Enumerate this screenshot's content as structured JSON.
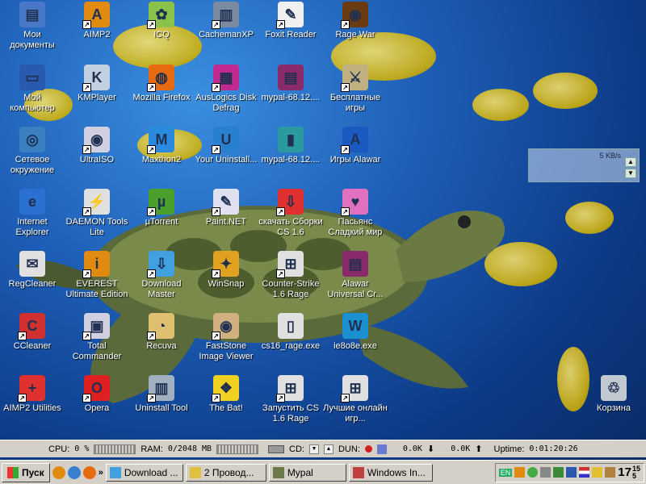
{
  "desktop": {
    "icons": [
      {
        "label": "Мои документы",
        "icon": "my-documents-icon",
        "color": "#4a78c8",
        "glyph": "▤",
        "shortcut": false
      },
      {
        "label": "AIMP2",
        "icon": "aimp2-icon",
        "color": "#e08a10",
        "glyph": "A",
        "shortcut": true
      },
      {
        "label": "ICQ",
        "icon": "icq-icon",
        "color": "#8bc34a",
        "glyph": "✿",
        "shortcut": true
      },
      {
        "label": "CachemanXP",
        "icon": "cachemanxp-icon",
        "color": "#7a8aa0",
        "glyph": "▥",
        "shortcut": true
      },
      {
        "label": "Foxit Reader",
        "icon": "foxit-reader-icon",
        "color": "#f0f0f0",
        "glyph": "✎",
        "shortcut": true
      },
      {
        "label": "Rage War",
        "icon": "rage-war-icon",
        "color": "#6a3a10",
        "glyph": "◉",
        "shortcut": true
      },
      {
        "label": "Мой компьютер",
        "icon": "my-computer-icon",
        "color": "#2a5ab0",
        "glyph": "▭",
        "shortcut": false
      },
      {
        "label": "KMPlayer",
        "icon": "kmplayer-icon",
        "color": "#c0d0e0",
        "glyph": "K",
        "shortcut": true
      },
      {
        "label": "Mozilla Firefox",
        "icon": "firefox-icon",
        "color": "#e86a10",
        "glyph": "◍",
        "shortcut": true
      },
      {
        "label": "AusLogics Disk Defrag",
        "icon": "disk-defrag-icon",
        "color": "#c02a90",
        "glyph": "▦",
        "shortcut": true
      },
      {
        "label": "mypal-68.12....",
        "icon": "archive-icon",
        "color": "#8a2a6a",
        "glyph": "▤",
        "shortcut": false
      },
      {
        "label": "Бесплатные игры",
        "icon": "free-games-icon",
        "color": "#c0b080",
        "glyph": "⚔",
        "shortcut": true
      },
      {
        "label": "Сетевое окружение",
        "icon": "network-places-icon",
        "color": "#3a80c0",
        "glyph": "◎",
        "shortcut": false
      },
      {
        "label": "UltraISO",
        "icon": "ultraiso-icon",
        "color": "#d0d0e0",
        "glyph": "◉",
        "shortcut": true
      },
      {
        "label": "Maxthon2",
        "icon": "maxthon2-icon",
        "color": "#2a8ae0",
        "glyph": "M",
        "shortcut": true
      },
      {
        "label": "Your Uninstall...",
        "icon": "your-uninstaller-icon",
        "color": "#2a80d0",
        "glyph": "U",
        "shortcut": true
      },
      {
        "label": "mypal-68.12....",
        "icon": "book-icon",
        "color": "#2a9aa0",
        "glyph": "▮",
        "shortcut": false
      },
      {
        "label": "Игры Alawar",
        "icon": "alawar-games-icon",
        "color": "#1a5ac0",
        "glyph": "A",
        "shortcut": true
      },
      {
        "label": "Internet Explorer",
        "icon": "internet-explorer-icon",
        "color": "#2a70d0",
        "glyph": "e",
        "shortcut": false
      },
      {
        "label": "DAEMON Tools Lite",
        "icon": "daemon-tools-icon",
        "color": "#e0e0e0",
        "glyph": "⚡",
        "shortcut": true
      },
      {
        "label": "µTorrent",
        "icon": "utorrent-icon",
        "color": "#4aa02a",
        "glyph": "µ",
        "shortcut": true
      },
      {
        "label": "Paint.NET",
        "icon": "paint-net-icon",
        "color": "#e0e0f0",
        "glyph": "✎",
        "shortcut": true
      },
      {
        "label": "скачать Сборки CS 1.6",
        "icon": "download-cs-icon",
        "color": "#e03030",
        "glyph": "⇩",
        "shortcut": true
      },
      {
        "label": "Пасьянс Сладкий мир",
        "icon": "solitaire-icon",
        "color": "#e070c0",
        "glyph": "♥",
        "shortcut": true
      },
      {
        "label": "RegCleaner",
        "icon": "regcleaner-icon",
        "color": "#e0e0e0",
        "glyph": "✉",
        "shortcut": false
      },
      {
        "label": "EVEREST Ultimate Edition",
        "icon": "everest-icon",
        "color": "#e08a10",
        "glyph": "i",
        "shortcut": true
      },
      {
        "label": "Download Master",
        "icon": "download-master-icon",
        "color": "#40a0e0",
        "glyph": "⇩",
        "shortcut": true
      },
      {
        "label": "WinSnap",
        "icon": "winsnap-icon",
        "color": "#e0a020",
        "glyph": "✦",
        "shortcut": true
      },
      {
        "label": "Counter-Strike 1.6 Rage",
        "icon": "counter-strike-icon",
        "color": "#e0e0e0",
        "glyph": "⊞",
        "shortcut": true
      },
      {
        "label": "Alawar Universal Cr...",
        "icon": "alawar-crack-icon",
        "color": "#8a2a6a",
        "glyph": "▤",
        "shortcut": false
      },
      {
        "label": "CCleaner",
        "icon": "ccleaner-icon",
        "color": "#d03030",
        "glyph": "C",
        "shortcut": true
      },
      {
        "label": "Total Commander",
        "icon": "total-commander-icon",
        "color": "#d0d0e0",
        "glyph": "▣",
        "shortcut": true
      },
      {
        "label": "Recuva",
        "icon": "recuva-icon",
        "color": "#e0c070",
        "glyph": "◔",
        "shortcut": true
      },
      {
        "label": "FastStone Image Viewer",
        "icon": "faststone-icon",
        "color": "#d0b080",
        "glyph": "◉",
        "shortcut": true
      },
      {
        "label": "cs16_rage.exe",
        "icon": "exe-file-icon",
        "color": "#e0e0e0",
        "glyph": "▯",
        "shortcut": false
      },
      {
        "label": "ie8o8e.exe",
        "icon": "ie-setup-icon",
        "color": "#1a90d0",
        "glyph": "W",
        "shortcut": false
      },
      {
        "label": "AIMP2 Utilities",
        "icon": "aimp2-utilities-icon",
        "color": "#e03030",
        "glyph": "+",
        "shortcut": true
      },
      {
        "label": "Opera",
        "icon": "opera-icon",
        "color": "#e02020",
        "glyph": "O",
        "shortcut": true
      },
      {
        "label": "Uninstall Tool",
        "icon": "uninstall-tool-icon",
        "color": "#a0b0c0",
        "glyph": "▥",
        "shortcut": true
      },
      {
        "label": "The Bat!",
        "icon": "the-bat-icon",
        "color": "#f0d020",
        "glyph": "❖",
        "shortcut": true
      },
      {
        "label": "Запустить CS 1.6 Rage",
        "icon": "launch-cs-icon",
        "color": "#e0e0e0",
        "glyph": "⊞",
        "shortcut": true
      },
      {
        "label": "Лучшие онлайн игр...",
        "icon": "online-games-icon",
        "color": "#e0e0e0",
        "glyph": "⊞",
        "shortcut": true
      },
      {
        "label": "Корзина",
        "icon": "recycle-bin-icon",
        "color": "#c0c8d0",
        "glyph": "♲",
        "shortcut": false
      }
    ]
  },
  "netmon": {
    "rate": "5 KB/s"
  },
  "statusbar": {
    "cpu_label": "CPU:",
    "cpu_value": "0 %",
    "ram_label": "RAM:",
    "ram_value": "0/2048 MB",
    "cd_label": "CD:",
    "dun_label": "DUN:",
    "down_value": "0.0K",
    "up_value": "0.0K",
    "uptime_label": "Uptime:",
    "uptime_value": "0:01:20:26"
  },
  "taskbar": {
    "start_label": "Пуск",
    "tasks": [
      {
        "label": "Download ...",
        "icon": "download-master-task-icon"
      },
      {
        "label": "2 Провод...",
        "icon": "explorer-task-icon"
      },
      {
        "label": "Mypal",
        "icon": "mypal-task-icon"
      },
      {
        "label": "Windows In...",
        "icon": "windows-installer-task-icon"
      }
    ],
    "lang": "EN",
    "clock_hour": "17",
    "clock_min_top": "15",
    "clock_min_bottom": "5"
  }
}
